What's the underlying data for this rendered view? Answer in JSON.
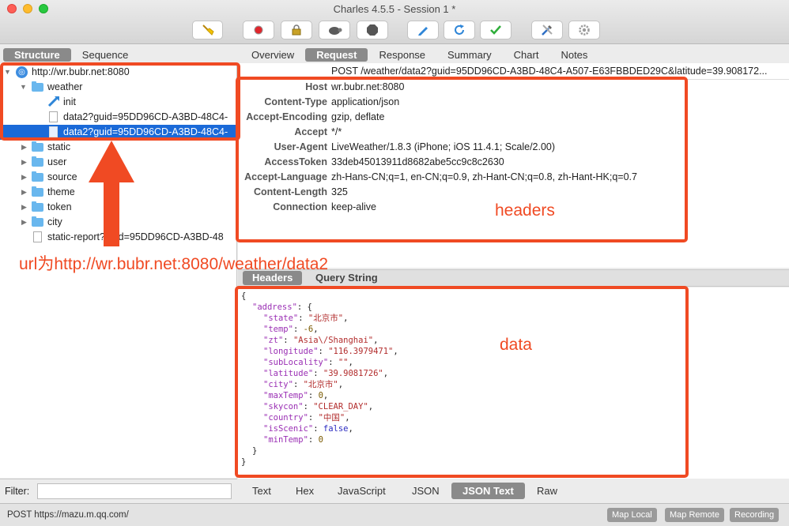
{
  "window": {
    "title": "Charles 4.5.5 - Session 1 *"
  },
  "left_tabs": [
    "Structure",
    "Sequence"
  ],
  "right_tabs": [
    "Overview",
    "Request",
    "Response",
    "Summary",
    "Chart",
    "Notes"
  ],
  "tree": {
    "host": "http://wr.bubr.net:8080",
    "items": [
      {
        "label": "weather"
      },
      {
        "label": "init"
      },
      {
        "label": "data2?guid=95DD96CD-A3BD-48C4-"
      },
      {
        "label": "data2?guid=95DD96CD-A3BD-48C4-"
      },
      {
        "label": "static"
      },
      {
        "label": "user"
      },
      {
        "label": "source"
      },
      {
        "label": "theme"
      },
      {
        "label": "token"
      },
      {
        "label": "city"
      },
      {
        "label": "static-report?guid=95DD96CD-A3BD-48"
      }
    ]
  },
  "request_line": "POST /weather/data2?guid=95DD96CD-A3BD-48C4-A507-E63FBBDED29C&latitude=39.908172...",
  "headers": [
    {
      "k": "Host",
      "v": "wr.bubr.net:8080"
    },
    {
      "k": "Content-Type",
      "v": "application/json"
    },
    {
      "k": "Accept-Encoding",
      "v": "gzip, deflate"
    },
    {
      "k": "Accept",
      "v": "*/*"
    },
    {
      "k": "User-Agent",
      "v": "LiveWeather/1.8.3 (iPhone; iOS 11.4.1; Scale/2.00)"
    },
    {
      "k": "AccessToken",
      "v": "33deb45013911d8682abe5cc9c8c2630"
    },
    {
      "k": "Accept-Language",
      "v": "zh-Hans-CN;q=1, en-CN;q=0.9, zh-Hant-CN;q=0.8, zh-Hant-HK;q=0.7"
    },
    {
      "k": "Content-Length",
      "v": "325"
    },
    {
      "k": "Connection",
      "v": "keep-alive"
    }
  ],
  "sub_tabs": [
    "Headers",
    "Query String"
  ],
  "json_lines": [
    {
      "i": 0,
      "t": [
        [
          "p",
          "{"
        ]
      ]
    },
    {
      "i": 1,
      "t": [
        [
          "k",
          "\"address\""
        ],
        [
          "p",
          ": {"
        ]
      ]
    },
    {
      "i": 2,
      "t": [
        [
          "k",
          "\"state\""
        ],
        [
          "p",
          ": "
        ],
        [
          "s",
          "\"北京市\""
        ],
        [
          "p",
          ","
        ]
      ]
    },
    {
      "i": 2,
      "t": [
        [
          "k",
          "\"temp\""
        ],
        [
          "p",
          ": "
        ],
        [
          "n",
          "-6"
        ],
        [
          "p",
          ","
        ]
      ]
    },
    {
      "i": 2,
      "t": [
        [
          "k",
          "\"zt\""
        ],
        [
          "p",
          ": "
        ],
        [
          "s",
          "\"Asia\\/Shanghai\""
        ],
        [
          "p",
          ","
        ]
      ]
    },
    {
      "i": 2,
      "t": [
        [
          "k",
          "\"longitude\""
        ],
        [
          "p",
          ": "
        ],
        [
          "s",
          "\"116.3979471\""
        ],
        [
          "p",
          ","
        ]
      ]
    },
    {
      "i": 2,
      "t": [
        [
          "k",
          "\"subLocality\""
        ],
        [
          "p",
          ": "
        ],
        [
          "s",
          "\"\""
        ],
        [
          "p",
          ","
        ]
      ]
    },
    {
      "i": 2,
      "t": [
        [
          "k",
          "\"latitude\""
        ],
        [
          "p",
          ": "
        ],
        [
          "s",
          "\"39.9081726\""
        ],
        [
          "p",
          ","
        ]
      ]
    },
    {
      "i": 2,
      "t": [
        [
          "k",
          "\"city\""
        ],
        [
          "p",
          ": "
        ],
        [
          "s",
          "\"北京市\""
        ],
        [
          "p",
          ","
        ]
      ]
    },
    {
      "i": 2,
      "t": [
        [
          "k",
          "\"maxTemp\""
        ],
        [
          "p",
          ": "
        ],
        [
          "n",
          "0"
        ],
        [
          "p",
          ","
        ]
      ]
    },
    {
      "i": 2,
      "t": [
        [
          "k",
          "\"skycon\""
        ],
        [
          "p",
          ": "
        ],
        [
          "s",
          "\"CLEAR_DAY\""
        ],
        [
          "p",
          ","
        ]
      ]
    },
    {
      "i": 2,
      "t": [
        [
          "k",
          "\"country\""
        ],
        [
          "p",
          ": "
        ],
        [
          "s",
          "\"中国\""
        ],
        [
          "p",
          ","
        ]
      ]
    },
    {
      "i": 2,
      "t": [
        [
          "k",
          "\"isScenic\""
        ],
        [
          "p",
          ": "
        ],
        [
          "b",
          "false"
        ],
        [
          "p",
          ","
        ]
      ]
    },
    {
      "i": 2,
      "t": [
        [
          "k",
          "\"minTemp\""
        ],
        [
          "p",
          ": "
        ],
        [
          "n",
          "0"
        ]
      ]
    },
    {
      "i": 1,
      "t": [
        [
          "p",
          "}"
        ]
      ]
    },
    {
      "i": 0,
      "t": [
        [
          "p",
          "}"
        ]
      ]
    }
  ],
  "bottom_tabs": [
    "Text",
    "Hex",
    "JavaScript",
    "JSON",
    "JSON Text",
    "Raw"
  ],
  "filter": {
    "label": "Filter:",
    "value": ""
  },
  "status": {
    "text": "POST https://mazu.m.qq.com/",
    "buttons": [
      "Map Local",
      "Map Remote",
      "Recording"
    ]
  },
  "annotations": {
    "headers": "headers",
    "data": "data",
    "url": "url为http://wr.bubr.net:8080/weather/data2"
  },
  "colors": {
    "annotation": "#f04a23",
    "selection": "#1b6ad8",
    "folder": "#69b7ee"
  },
  "toolbar_icons": [
    "broom-icon",
    "record-icon",
    "lock-icon",
    "turtle-icon",
    "stop-icon",
    "pen-icon",
    "refresh-icon",
    "check-icon",
    "tools-icon",
    "gear-icon"
  ]
}
